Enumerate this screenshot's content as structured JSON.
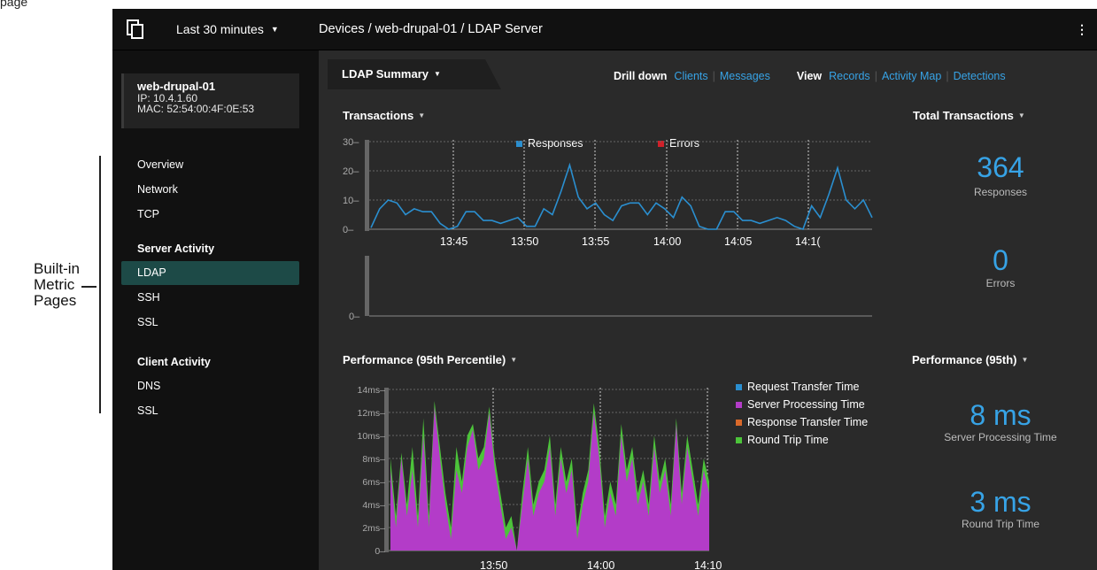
{
  "page_cut_text": "page",
  "annotation": {
    "text_lines": [
      "Built-in",
      "Metric",
      "Pages"
    ]
  },
  "topbar": {
    "time_range": "Last 30 minutes",
    "breadcrumb": "Devices / web-drupal-01 / LDAP Server"
  },
  "device": {
    "name": "web-drupal-01",
    "ip": "IP: 10.4.1.60",
    "mac": "MAC: 52:54:00:4F:0E:53"
  },
  "sidebar": {
    "top_items": [
      "Overview",
      "Network",
      "TCP"
    ],
    "server_activity": {
      "heading": "Server Activity",
      "items": [
        "LDAP",
        "SSH",
        "SSL"
      ],
      "active": "LDAP"
    },
    "client_activity": {
      "heading": "Client Activity",
      "items": [
        "DNS",
        "SSL"
      ]
    }
  },
  "main": {
    "tab_label": "LDAP Summary",
    "drill_down": {
      "label": "Drill down",
      "links": [
        "Clients",
        "Messages"
      ]
    },
    "view": {
      "label": "View",
      "links": [
        "Records",
        "Activity Map",
        "Detections"
      ]
    },
    "transactions_title": "Transactions",
    "total_title": "Total Transactions",
    "responses_value": "364",
    "responses_label": "Responses",
    "errors_value": "0",
    "errors_label": "Errors",
    "performance_title": "Performance (95th Percentile)",
    "performance_side_title": "Performance (95th)",
    "server_processing_value": "8 ms",
    "server_processing_label": "Server Processing Time",
    "round_trip_value": "3 ms",
    "round_trip_label": "Round Trip Time"
  },
  "colors": {
    "accent": "#37a3e6",
    "active_nav": "#1d4a47",
    "responses": "#2a8fd0",
    "errors": "#d0202a",
    "request_transfer": "#2a8fd0",
    "server_processing": "#b33cc8",
    "response_transfer": "#d9692a",
    "round_trip": "#4cc43a"
  },
  "chart_data": [
    {
      "type": "line",
      "title": "Transactions",
      "series": [
        {
          "name": "Responses",
          "values": [
            0.5,
            7,
            10,
            9,
            5,
            7,
            6,
            6,
            2,
            0,
            1,
            6,
            6,
            3,
            3,
            2,
            3,
            4,
            1,
            1,
            7,
            5,
            13,
            22,
            11,
            7,
            9,
            5,
            3,
            8,
            9,
            9,
            5,
            9,
            7,
            4,
            11,
            8,
            1,
            0,
            0,
            6,
            6,
            3,
            3,
            2,
            3,
            4,
            3,
            1,
            0,
            8,
            4,
            12,
            21,
            10,
            7,
            10,
            4
          ]
        },
        {
          "name": "Errors",
          "values": []
        }
      ],
      "x_tick_labels": [
        "13:45",
        "13:50",
        "13:55",
        "14:00",
        "14:05",
        "14:1("
      ],
      "y_ticks": [
        0,
        10,
        20,
        30
      ],
      "ylim": [
        0,
        30
      ],
      "grid": true,
      "legend_placement": "top-center"
    },
    {
      "type": "line",
      "series": [
        {
          "name": "Errors",
          "values": []
        }
      ],
      "y_ticks": [
        0
      ]
    },
    {
      "type": "area",
      "title": "Performance (95th Percentile)",
      "y_tick_labels": [
        "0",
        "2ms",
        "4ms",
        "6ms",
        "8ms",
        "10ms",
        "12ms",
        "14ms"
      ],
      "ylim": [
        0,
        14
      ],
      "x_tick_labels": [
        "13:50",
        "14:00",
        "14:10"
      ],
      "series": [
        {
          "name": "Server Processing Time",
          "values": [
            7,
            2,
            8,
            3,
            7,
            2,
            10,
            2,
            12.5,
            8,
            4,
            1,
            7,
            5,
            9,
            10.5,
            7,
            8,
            12,
            7,
            4,
            1,
            2,
            0,
            4,
            8,
            3,
            5,
            6,
            9,
            3,
            8,
            5,
            7,
            1,
            4,
            6,
            12,
            8,
            2,
            5,
            3,
            10,
            6,
            8,
            4,
            6,
            3,
            9,
            5,
            7,
            3,
            11,
            4,
            9,
            6,
            3,
            7,
            5
          ]
        },
        {
          "name": "Round Trip Time",
          "values": [
            8,
            3,
            8.5,
            4,
            9,
            3,
            11.5,
            3,
            13,
            9,
            5,
            2,
            9,
            6,
            10,
            11,
            8,
            9,
            12.5,
            8,
            5,
            2,
            3,
            0,
            5,
            9,
            4,
            6,
            7,
            10,
            4,
            9,
            6,
            8,
            2,
            5,
            7,
            12.8,
            9,
            3,
            6,
            4,
            11,
            7,
            9,
            5,
            7,
            4,
            10,
            6,
            8,
            4,
            11.5,
            5,
            10,
            7,
            4,
            8,
            6
          ]
        },
        {
          "name": "Request Transfer Time",
          "values": []
        },
        {
          "name": "Response Transfer Time",
          "values": []
        }
      ],
      "grid": true,
      "legend_placement": "right"
    }
  ]
}
